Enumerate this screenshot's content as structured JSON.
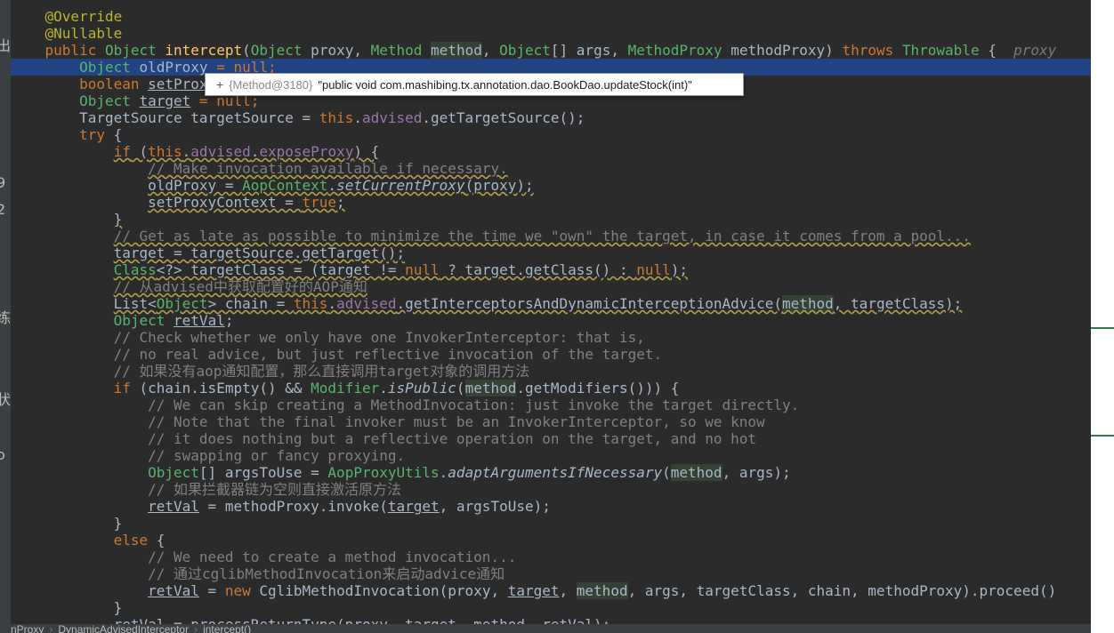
{
  "left_strip": [
    "出",
    "9",
    "2",
    "练",
    "状",
    "o",
    ";"
  ],
  "code": {
    "l1": "@Override",
    "l2": "@Nullable",
    "l3": {
      "public": "public ",
      "Object": "Object ",
      "name": "intercept",
      "open": "(",
      "pt1": "Object",
      "p1": " proxy, ",
      "pt2": "Method",
      "p2": " ",
      "method": "method",
      "p3": ", ",
      "pt3": "Object",
      "p4": "[] args, ",
      "pt4": "MethodProxy",
      "p5": " methodProxy) ",
      "throws": "throws ",
      "throwable": "Throwable",
      "p6": " {  ",
      "hint": "proxy"
    },
    "l4": {
      "type": "Object",
      "var": " oldProxy",
      "rest": " = null;"
    },
    "l5": {
      "kw": "boolean ",
      "var": "setProx"
    },
    "l6": {
      "type": "Object",
      "sp": " ",
      "var": "target",
      "rest": " = null;"
    },
    "l7": {
      "a": "TargetSource targetSource = ",
      "this": "this",
      "dot": ".",
      "field": "advised",
      "b": ".getTargetSource();"
    },
    "l8": {
      "kw": "try",
      "b": " {"
    },
    "l9": {
      "kw": "if",
      "a": " (",
      "this": "this",
      "dot": ".",
      "field": "advised",
      "dot2": ".",
      "field2": "exposeProxy",
      "b": ") {"
    },
    "l10": "// Make invocation available if necessary.",
    "l11": {
      "a": "oldProxy = ",
      "cls": "AopContext",
      "dot": ".",
      "fn": "setCurrentProxy",
      "b": "(proxy);"
    },
    "l12": {
      "a": "setProxyContext = ",
      "kw": "true",
      "b": ";"
    },
    "l13": "}",
    "l14": "// Get as late as possible to minimize the time we \"own\" the target, in case it comes from a pool...",
    "l15": "target = targetSource.getTarget();",
    "l16": {
      "cls": "Class",
      "a": "<?> targetClass = (target != ",
      "null1": "null",
      "b": " ? target.getClass() : ",
      "null2": "null",
      "c": ");"
    },
    "l17": "// 从advised中获取配置好的AOP通知",
    "l18": {
      "a": "List<",
      "type": "Object",
      "b": "> chain = ",
      "this": "this",
      "dot": ".",
      "field": "advised",
      "c": ".getInterceptorsAndDynamicInterceptionAdvice(",
      "method": "method",
      "d": ", targetClass);"
    },
    "l19": {
      "type": "Object",
      "sp": " ",
      "var": "retVal",
      "b": ";"
    },
    "l20": "// Check whether we only have one InvokerInterceptor: that is,",
    "l21": "// no real advice, but just reflective invocation of the target.",
    "l22": "// 如果没有aop通知配置，那么直接调用target对象的调用方法",
    "l23": {
      "kw": "if",
      "a": " (chain.isEmpty() && ",
      "cls": "Modifier",
      "dot": ".",
      "fn": "isPublic",
      "b": "(",
      "method": "method",
      "c": ".getModifiers())) {"
    },
    "l24": "// We can skip creating a MethodInvocation: just invoke the target directly.",
    "l25": "// Note that the final invoker must be an InvokerInterceptor, so we know",
    "l26": "// it does nothing but a reflective operation on the target, and no hot",
    "l27": "// swapping or fancy proxying.",
    "l28": {
      "type": "Object",
      "a": "[] argsToUse = ",
      "cls": "AopProxyUtils",
      "dot": ".",
      "fn": "adaptArgumentsIfNecessary",
      "b": "(",
      "method": "method",
      "c": ", args);"
    },
    "l29": "// 如果拦截器链为空则直接激活原方法",
    "l30": {
      "var": "retVal",
      "a": " = methodProxy.invoke(",
      "var2": "target",
      "b": ", argsToUse);"
    },
    "l31": "}",
    "l32": {
      "kw": "else",
      "b": " {"
    },
    "l33": "// We need to create a method invocation...",
    "l34": "// 通过cglibMethodInvocation来启动advice通知",
    "l35": {
      "var": "retVal",
      "a": " = ",
      "kw": "new",
      "b": " CglibMethodInvocation(proxy, ",
      "var2": "target",
      "c": ", ",
      "method": "method",
      "d": ", args, targetClass, chain, methodProxy).proceed()"
    },
    "l36": "}",
    "l37": "retVal = processReturnType(proxy, target, method, retVal);"
  },
  "tooltip": {
    "plus": "+",
    "type": "{Method@3180}",
    "value": "\"public void com.mashibing.tx.annotation.dao.BookDao.updateStock(int)\""
  },
  "breadcrumb": [
    "nProxy",
    "DynamicAdvisedInterceptor",
    "intercept()"
  ]
}
